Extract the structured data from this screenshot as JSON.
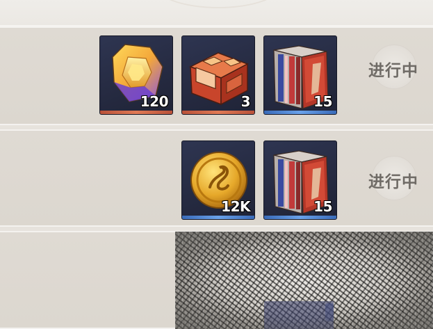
{
  "rows": [
    {
      "status": "进行中",
      "items": [
        {
          "name": "gem",
          "count": "120",
          "strip": "orange"
        },
        {
          "name": "chest",
          "count": "3",
          "strip": "orange"
        },
        {
          "name": "books",
          "count": "15",
          "strip": "blue"
        }
      ]
    },
    {
      "status": "进行中",
      "items": [
        {
          "name": "gold-coin",
          "count": "12K",
          "strip": "blue"
        },
        {
          "name": "books",
          "count": "15",
          "strip": "blue"
        }
      ]
    },
    {
      "status": "",
      "items": []
    }
  ],
  "colors": {
    "panel_bg": "#dfdad3",
    "tile_bg": "#262b42",
    "strip_orange": "#e07a55",
    "strip_blue": "#6aa2ea",
    "status_text": "#6f6b66"
  }
}
